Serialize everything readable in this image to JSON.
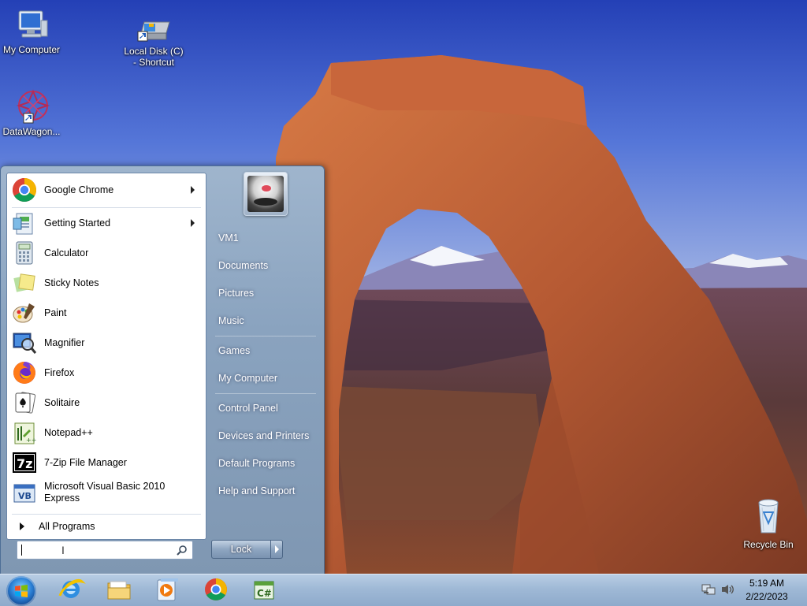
{
  "desktop_icons": [
    {
      "label": "My Computer",
      "icon": "computer-icon"
    },
    {
      "label": "Local Disk (C) - Shortcut",
      "icon": "drive-shortcut-icon"
    },
    {
      "label": "DataWagon...",
      "icon": "datawagon-icon"
    },
    {
      "label": "Recycle Bin",
      "icon": "recycle-bin-icon"
    }
  ],
  "start_menu": {
    "programs": [
      {
        "label": "Google Chrome",
        "icon": "chrome-icon",
        "has_submenu": true
      },
      {
        "label": "Getting Started",
        "icon": "getting-started-icon",
        "has_submenu": true
      },
      {
        "label": "Calculator",
        "icon": "calculator-icon"
      },
      {
        "label": "Sticky Notes",
        "icon": "sticky-notes-icon"
      },
      {
        "label": "Paint",
        "icon": "paint-icon"
      },
      {
        "label": "Magnifier",
        "icon": "magnifier-icon"
      },
      {
        "label": "Firefox",
        "icon": "firefox-icon"
      },
      {
        "label": "Solitaire",
        "icon": "solitaire-icon"
      },
      {
        "label": "Notepad++",
        "icon": "notepadpp-icon"
      },
      {
        "label": "7-Zip File Manager",
        "icon": "sevenzip-icon"
      },
      {
        "label_line1": "Microsoft Visual Basic 2010",
        "label_line2": "Express",
        "icon": "visual-basic-icon"
      }
    ],
    "all_programs": "All Programs",
    "search_value": "",
    "right_links": {
      "user": "VM1",
      "documents": "Documents",
      "pictures": "Pictures",
      "music": "Music",
      "games": "Games",
      "computer": "My Computer",
      "control_panel": "Control Panel",
      "devices": "Devices and Printers",
      "default_programs": "Default Programs",
      "help": "Help and Support"
    },
    "lock_label": "Lock"
  },
  "taskbar": {
    "pinned": [
      "internet-explorer-icon",
      "file-explorer-icon",
      "media-player-icon",
      "chrome-icon",
      "csharp-icon"
    ],
    "time": "5:19 AM",
    "date": "2/22/2023"
  }
}
